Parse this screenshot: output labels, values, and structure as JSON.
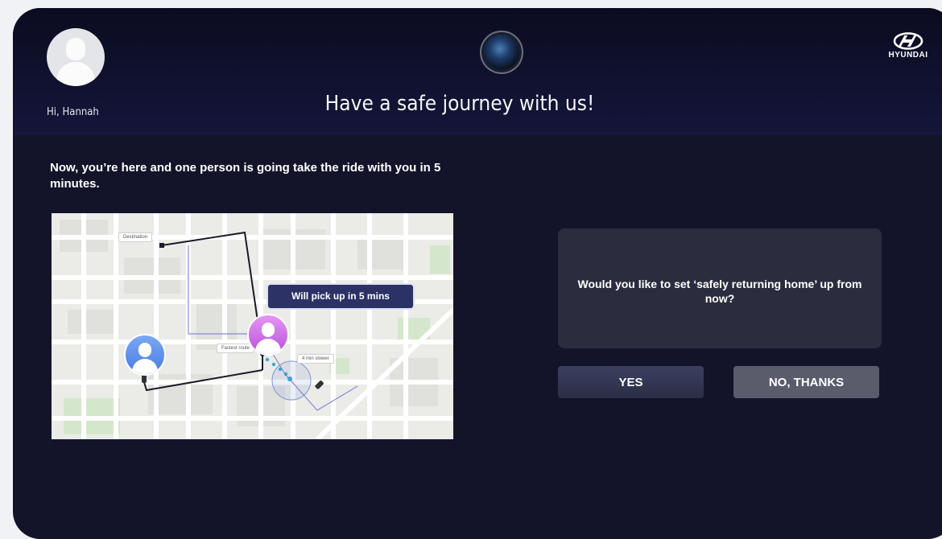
{
  "header": {
    "greeting": "Hi, Hannah",
    "title": "Have a safe journey with us!",
    "brand": "HYUNDAI"
  },
  "main": {
    "message": "Now, you’re here and one person is going take the ride with you in 5 minutes.",
    "map": {
      "pickup_label": "Will pick up in 5 mins",
      "destination_tag": "Destination",
      "fastest_route_tag": "Fastest route",
      "slower_tag": "4 min slower"
    },
    "dialog": {
      "question": "Would you like to set ‘safely returning home’ up from now?",
      "yes_label": "YES",
      "no_label": "NO, THANKS"
    }
  },
  "colors": {
    "header_bg": "#0b0c20",
    "screen_bg": "#13142a",
    "dialog_bg": "#2b2d3f",
    "pickup_label_bg": "#2c3166",
    "avatar_blue": "#4a7ce0",
    "avatar_purple": "#b752d8"
  },
  "icons": {
    "user_avatar": "user-avatar-icon",
    "camera": "camera-icon",
    "brand_logo": "hyundai-logo-icon"
  }
}
